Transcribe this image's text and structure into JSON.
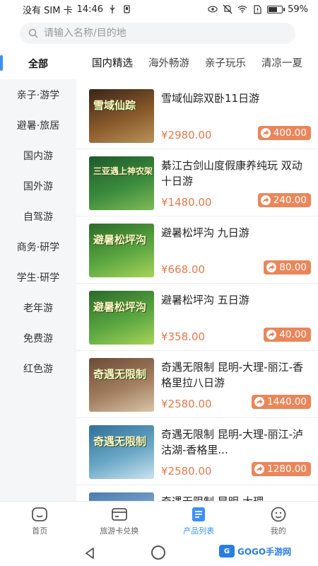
{
  "status_bar": {
    "carrier": "没有 SIM 卡",
    "time": "14:46",
    "battery": "59%"
  },
  "search": {
    "placeholder": "请输入名称/目的地"
  },
  "sidebar": {
    "items": [
      {
        "label": "全部",
        "active": true
      },
      {
        "label": "亲子·游学"
      },
      {
        "label": "避暑·旅居"
      },
      {
        "label": "国内游"
      },
      {
        "label": "国外游"
      },
      {
        "label": "自驾游"
      },
      {
        "label": "商务·研学"
      },
      {
        "label": "学生·研学"
      },
      {
        "label": "老年游"
      },
      {
        "label": "免费游"
      },
      {
        "label": "红色游"
      }
    ]
  },
  "tabs": [
    {
      "label": "国内精选",
      "active": true
    },
    {
      "label": "海外畅游"
    },
    {
      "label": "亲子玩乐"
    },
    {
      "label": "清凉一夏"
    }
  ],
  "products": [
    {
      "name": "雪域仙踪双卧11日游",
      "price": "¥2980.00",
      "reward": "400.00",
      "thumb_text": "雪域仙踪",
      "thumb_colors": [
        "#3a2418",
        "#8a5a2b",
        "#b7935a"
      ]
    },
    {
      "name": "綦江古剑山度假康养纯玩 双动十日游",
      "price": "¥1480.00",
      "reward": "240.00",
      "thumb_text": "三亚遇上神农架",
      "thumb_colors": [
        "#1e5a2a",
        "#3b8a3e",
        "#7dbb57"
      ]
    },
    {
      "name": "避暑松坪沟 九日游",
      "price": "¥668.00",
      "reward": "80.00",
      "thumb_text": "避暑松坪沟",
      "thumb_colors": [
        "#2b6a2a",
        "#5aa640",
        "#a7d35a"
      ]
    },
    {
      "name": "避暑松坪沟 五日游",
      "price": "¥358.00",
      "reward": "40.00",
      "thumb_text": "避暑松坪沟",
      "thumb_colors": [
        "#2b6a2a",
        "#5aa640",
        "#a7d35a"
      ]
    },
    {
      "name": "奇遇无限制 昆明-大理-丽江-香格里拉八日游",
      "price": "¥2580.00",
      "reward": "1440.00",
      "thumb_text": "奇遇无限制",
      "thumb_colors": [
        "#6b4b36",
        "#a27d5f",
        "#d8c4a8"
      ]
    },
    {
      "name": "奇遇无限制 昆明-大理-丽江-泸沽湖-香格里...",
      "price": "¥2580.00",
      "reward": "1280.00",
      "thumb_text": "奇遇无限制",
      "thumb_colors": [
        "#2f6e9a",
        "#6aa7c6",
        "#c9e3ee"
      ]
    },
    {
      "name": "奇遇无限制 昆明-大理-",
      "price": "",
      "reward": "",
      "thumb_text": "",
      "thumb_colors": [
        "#4b7bb0",
        "#7fa7cf",
        "#d7e6f2"
      ]
    }
  ],
  "tabbar": {
    "items": [
      {
        "label": "首页",
        "icon": "home-icon"
      },
      {
        "label": "旅游卡兑换",
        "icon": "card-icon"
      },
      {
        "label": "产品列表",
        "icon": "list-icon",
        "active": true
      },
      {
        "label": "我的",
        "icon": "profile-icon"
      }
    ]
  },
  "watermark": {
    "text": "GOGO手游网"
  },
  "colors": {
    "accent": "#3c8ff5",
    "price": "#e07a4d",
    "badge": "#e9865a"
  }
}
